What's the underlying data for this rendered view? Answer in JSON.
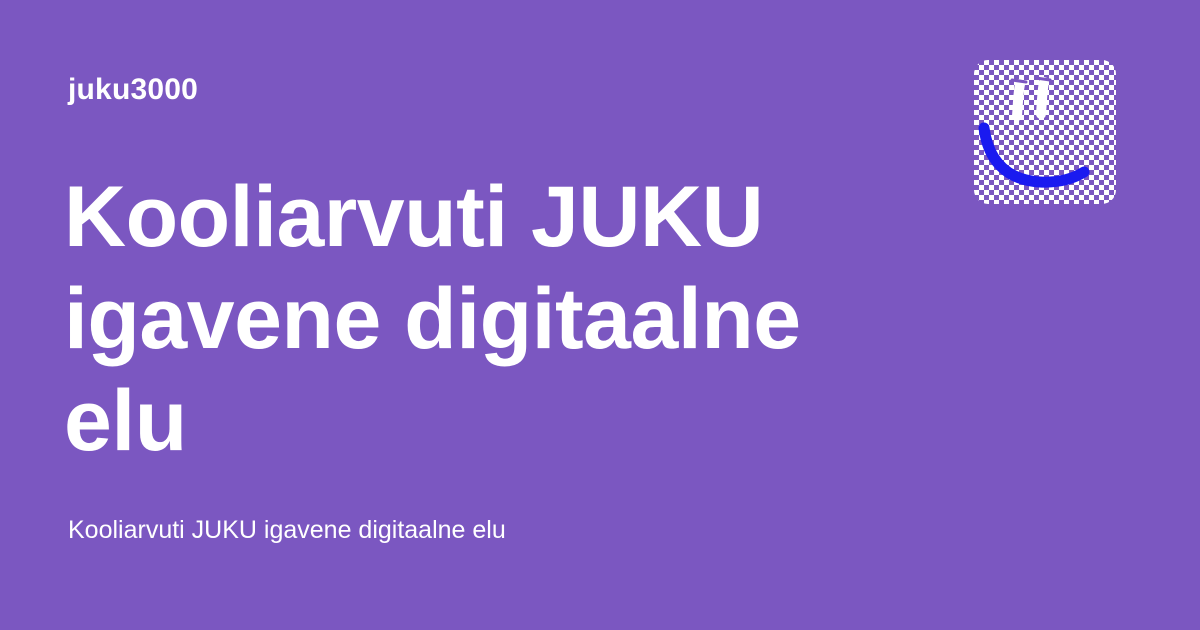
{
  "site": {
    "name": "juku3000"
  },
  "post": {
    "title": "Kooliarvuti JUKU igavene digitaalne elu",
    "excerpt": "Kooliarvuti JUKU igavene digitaalne elu"
  },
  "logo": {
    "icon": "smiley-face-icon"
  },
  "colors": {
    "background": "#7b57c1",
    "text": "#ffffff",
    "logo_smile": "#1a1af0",
    "logo_check_light": "#ffffff",
    "logo_check_dark": "#7b57c1"
  }
}
